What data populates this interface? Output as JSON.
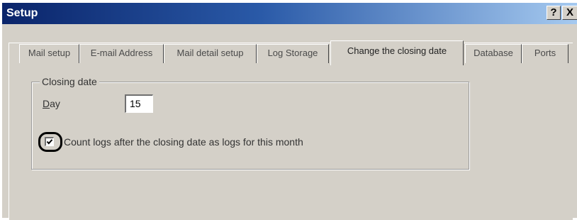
{
  "window": {
    "title": "Setup",
    "help_button": "?",
    "close_button": "X"
  },
  "tabs": [
    {
      "label": "Mail setup",
      "active": false
    },
    {
      "label": "E-mail Address",
      "active": false
    },
    {
      "label": "Mail detail setup",
      "active": false
    },
    {
      "label": "Log Storage",
      "active": false
    },
    {
      "label": "Change the closing date",
      "active": true
    },
    {
      "label": "Database",
      "active": false
    },
    {
      "label": "Ports",
      "active": false
    }
  ],
  "closing_date": {
    "group_label": "Closing date",
    "day_label_first": "D",
    "day_label_rest": "ay",
    "day_value": "15",
    "count_logs_label": "Count logs after the closing date as logs for this month",
    "count_logs_checked": true
  },
  "icons": {
    "checkmark": "checkmark-icon",
    "close": "close-icon",
    "help": "help-icon"
  }
}
